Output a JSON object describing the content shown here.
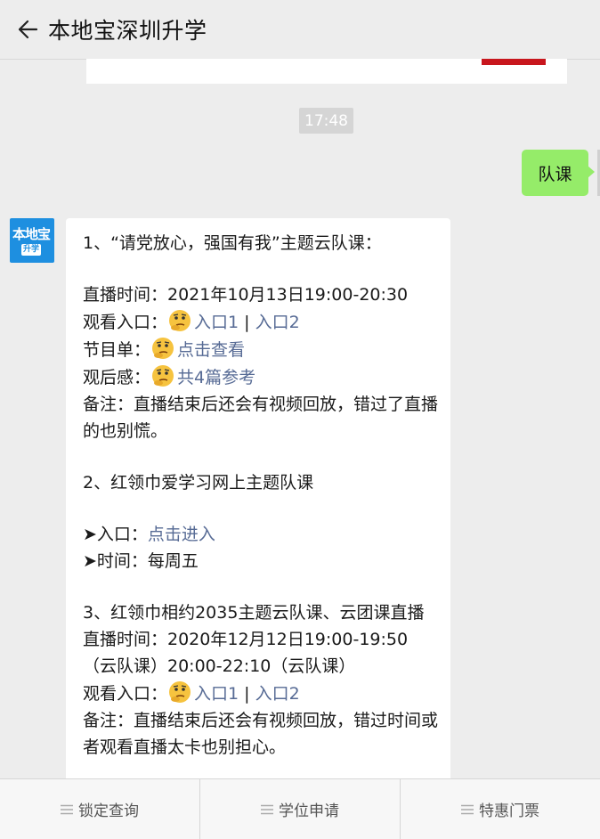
{
  "header": {
    "title": "本地宝深圳升学",
    "back_icon": "back-arrow-icon"
  },
  "time_label": "17:48",
  "sent_message": "队课",
  "avatar": {
    "line1": "本地宝",
    "line2": "升学"
  },
  "message": {
    "s1_title": "1、“请党放心，强国有我”主题云队课：",
    "s1_time": "直播时间：2021年10月13日19:00-20:30",
    "s1_watch_label": "观看入口：",
    "s1_link1": "入口1",
    "s1_sep": " | ",
    "s1_link2": "入口2",
    "s1_program_label": "节目单：",
    "s1_program_link": "点击查看",
    "s1_review_label": "观后感：",
    "s1_review_link": "共4篇参考",
    "s1_note": "备注：直播结束后还会有视频回放，错过了直播的也别慌。",
    "s2_title": "2、红领巾爱学习网上主题队课",
    "s2_entry_label": "➤入口：",
    "s2_entry_link": "点击进入",
    "s2_time": "➤时间：每周五",
    "s3_title": "3、红领巾相约2035主题云队课、云团课直播",
    "s3_time": "直播时间：2020年12月12日19:00-19:50（云队课）20:00-22:10（云队课）",
    "s3_watch_label": "观看入口：",
    "s3_link1": "入口1",
    "s3_sep": " | ",
    "s3_link2": "入口2",
    "s3_note": "备注：直播结束后还会有视频回放，错过时间或者观看直播太卡也别担心。"
  },
  "bottom_menu": [
    {
      "label": "锁定查询"
    },
    {
      "label": "学位申请"
    },
    {
      "label": "特惠门票"
    }
  ],
  "colors": {
    "link": "#576b95",
    "sent_bubble": "#95ec69",
    "background": "#ededed"
  }
}
